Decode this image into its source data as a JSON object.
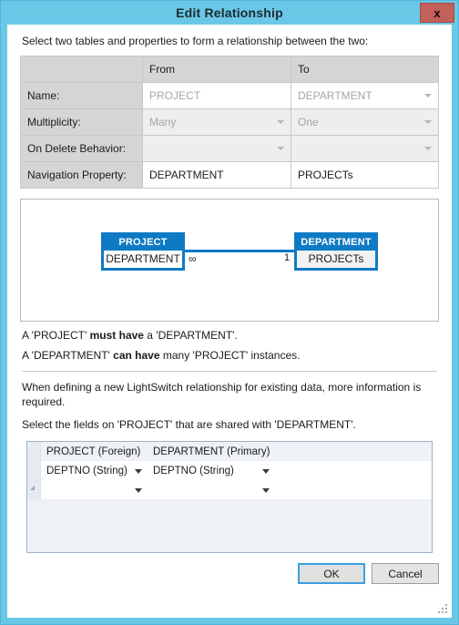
{
  "window": {
    "title": "Edit Relationship",
    "close_label": "x",
    "close_icon": "close-icon",
    "accent_blue": "#6ac7e6",
    "close_red": "#c2605a",
    "entity_blue": "#0f7ac4"
  },
  "intro": "Select two tables and properties to form a relationship between the two:",
  "grid": {
    "headers": [
      "",
      "From",
      "To"
    ],
    "rows": [
      {
        "label": "Name:",
        "from": {
          "value": "PROJECT",
          "style": "readonly-text",
          "dropdown": false
        },
        "to": {
          "value": "DEPARTMENT",
          "style": "readonly-text",
          "dropdown": true
        }
      },
      {
        "label": "Multiplicity:",
        "from": {
          "value": "Many",
          "style": "disabled",
          "dropdown": true
        },
        "to": {
          "value": "One",
          "style": "disabled",
          "dropdown": true
        }
      },
      {
        "label": "On Delete Behavior:",
        "from": {
          "value": "",
          "style": "disabled",
          "dropdown": true
        },
        "to": {
          "value": "",
          "style": "disabled",
          "dropdown": true
        }
      },
      {
        "label": "Navigation Property:",
        "from": {
          "value": "DEPARTMENT",
          "style": "editable",
          "dropdown": false
        },
        "to": {
          "value": "PROJECTs",
          "style": "editable",
          "dropdown": false
        }
      }
    ]
  },
  "diagram": {
    "left_entity": {
      "title": "PROJECT",
      "field": "DEPARTMENT"
    },
    "right_entity": {
      "title": "DEPARTMENT",
      "field": "PROJECTs"
    },
    "left_multiplicity": "∞",
    "right_multiplicity": "1"
  },
  "sentences": {
    "line1_a": "A 'PROJECT' ",
    "line1_b": "must have",
    "line1_c": " a 'DEPARTMENT'.",
    "line2_a": "A 'DEPARTMENT' ",
    "line2_b": "can have",
    "line2_c": " many 'PROJECT' instances."
  },
  "notes": {
    "note1": "When defining a new LightSwitch relationship for existing data, more information is required.",
    "note2": "Select the fields on 'PROJECT' that are shared with 'DEPARTMENT'."
  },
  "mapping": {
    "headers": [
      "PROJECT  (Foreign)",
      "DEPARTMENT  (Primary)"
    ],
    "rows": [
      {
        "foreign": "DEPTNO (String)",
        "primary": "DEPTNO (String)",
        "selected": false
      },
      {
        "foreign": "",
        "primary": "",
        "selected": true
      }
    ]
  },
  "buttons": {
    "ok": "OK",
    "cancel": "Cancel"
  }
}
